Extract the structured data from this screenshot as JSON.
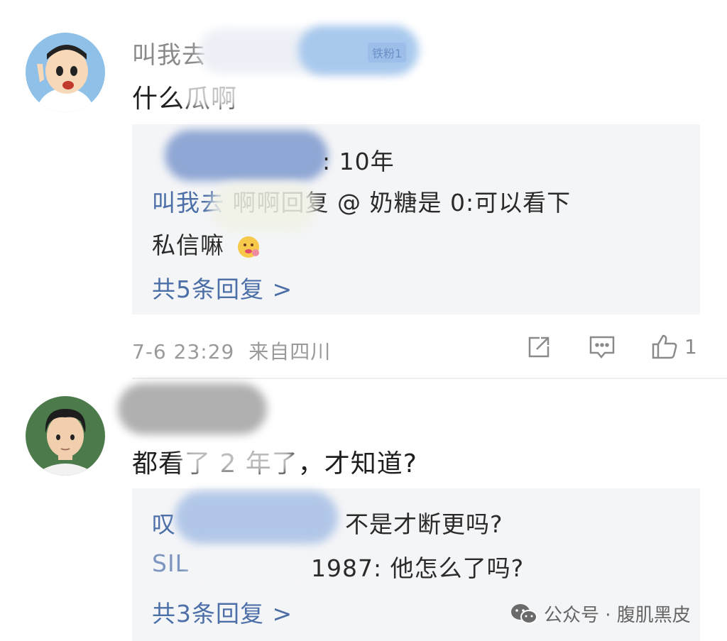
{
  "comments": [
    {
      "username": "叫我去",
      "badge": "铁粉1",
      "text": "什么瓜啊",
      "replies": [
        {
          "name": "",
          "text": ": 10年"
        },
        {
          "name": "叫我去",
          "text": "啊啊回复 @ 奶糖是 0:可以看下"
        },
        {
          "name": "",
          "text": "私信嘛"
        }
      ],
      "reply_count": "共5条回复 >",
      "timestamp": "7-6 23:29",
      "location": "来自四川",
      "likes": "1"
    },
    {
      "username": "",
      "text": "都看了 2 年了，才知道?",
      "replies": [
        {
          "name": "叹",
          "text": "不是才断更吗?"
        },
        {
          "name": "SIL",
          "text": "1987: 他怎么了吗?"
        }
      ],
      "reply_count": "共3条回复 >"
    }
  ],
  "watermark": {
    "label": "公众号 · 腹肌黑皮",
    "icon": "wechat-icon"
  },
  "colors": {
    "link": "#4d6fa8",
    "reply_bg": "#f4f5f7",
    "muted": "#9a9a9a"
  }
}
